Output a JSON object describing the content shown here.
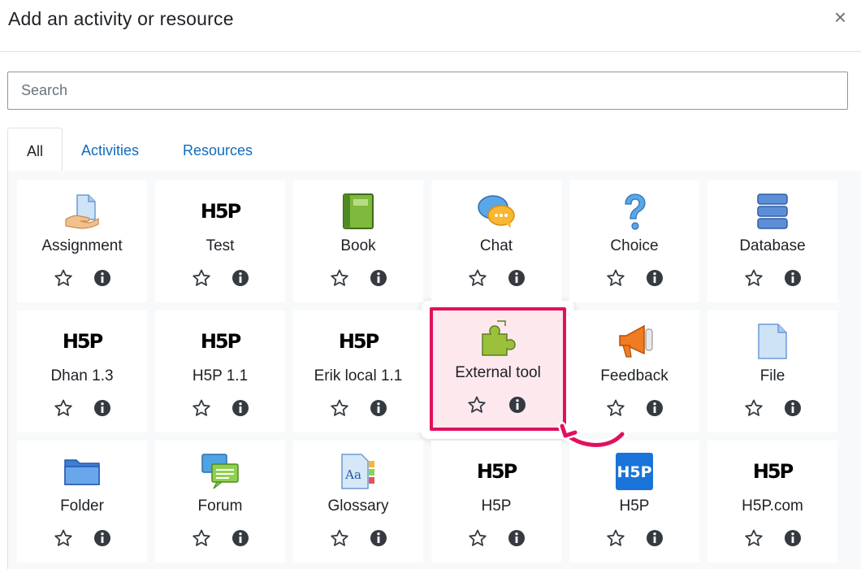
{
  "dialog": {
    "title": "Add an activity or resource",
    "close_label": "×"
  },
  "search": {
    "placeholder": "Search"
  },
  "tabs": [
    {
      "label": "All",
      "active": true
    },
    {
      "label": "Activities",
      "active": false
    },
    {
      "label": "Resources",
      "active": false
    }
  ],
  "items": [
    {
      "label": "Assignment",
      "icon": "assignment-icon"
    },
    {
      "label": "Test",
      "icon": "h5p-icon"
    },
    {
      "label": "Book",
      "icon": "book-icon"
    },
    {
      "label": "Chat",
      "icon": "chat-icon"
    },
    {
      "label": "Choice",
      "icon": "choice-icon"
    },
    {
      "label": "Database",
      "icon": "database-icon"
    },
    {
      "label": "Dhan 1.3",
      "icon": "h5p-icon"
    },
    {
      "label": "H5P 1.1",
      "icon": "h5p-icon"
    },
    {
      "label": "Erik local 1.1",
      "icon": "h5p-icon"
    },
    {
      "label": "External tool",
      "icon": "puzzle-icon",
      "highlighted": true
    },
    {
      "label": "Feedback",
      "icon": "megaphone-icon"
    },
    {
      "label": "File",
      "icon": "file-icon"
    },
    {
      "label": "Folder",
      "icon": "folder-icon"
    },
    {
      "label": "Forum",
      "icon": "forum-icon"
    },
    {
      "label": "Glossary",
      "icon": "glossary-icon"
    },
    {
      "label": "H5P",
      "icon": "h5p-icon"
    },
    {
      "label": "H5P",
      "icon": "h5p-blue-icon"
    },
    {
      "label": "H5P.com",
      "icon": "h5p-icon"
    }
  ],
  "h5p_logo_text": "H5P",
  "glossary_logo_text": "Aa",
  "colors": {
    "link": "#0f6cbf",
    "highlight_border": "#e0115f",
    "highlight_fill": "#fde8ee",
    "action_icon": "#343a40"
  }
}
